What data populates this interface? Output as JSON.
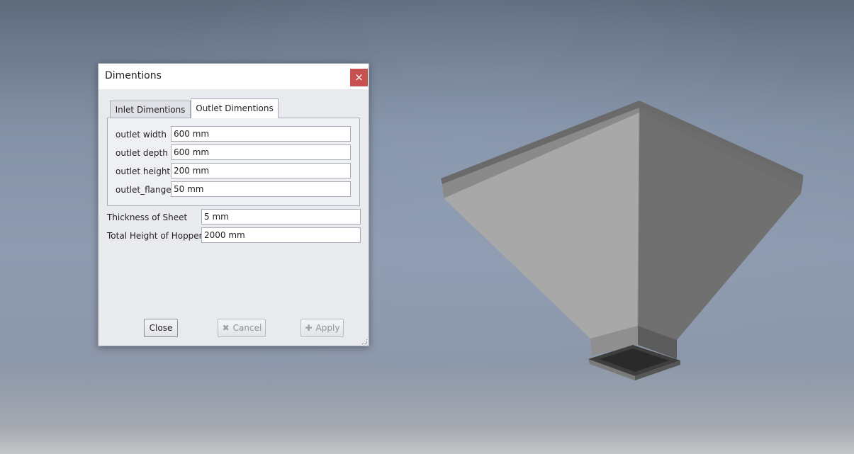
{
  "dialog": {
    "title": "Dimentions",
    "close_glyph": "×",
    "tabs": [
      {
        "label": "Inlet Dimentions",
        "active": false
      },
      {
        "label": "Outlet Dimentions",
        "active": true
      }
    ],
    "outlet_fields": [
      {
        "label": "outlet width",
        "value": "600 mm"
      },
      {
        "label": "outlet depth",
        "value": "600 mm"
      },
      {
        "label": "outlet height",
        "value": "200 mm"
      },
      {
        "label": "outlet_flange",
        "value": "50 mm"
      }
    ],
    "common_fields": [
      {
        "label": "Thickness of Sheet",
        "value": "5 mm"
      },
      {
        "label": "Total Height of Hopper",
        "value": "2000 mm"
      }
    ],
    "buttons": {
      "close": "Close",
      "cancel": "Cancel",
      "apply": "Apply",
      "cancel_icon": "✖",
      "apply_icon": "✚"
    }
  },
  "viewport": {
    "model": "hopper",
    "background_top": "#5f6b7c",
    "background_mid": "#8e9bb0",
    "background_bottom": "#c4c5c8"
  }
}
